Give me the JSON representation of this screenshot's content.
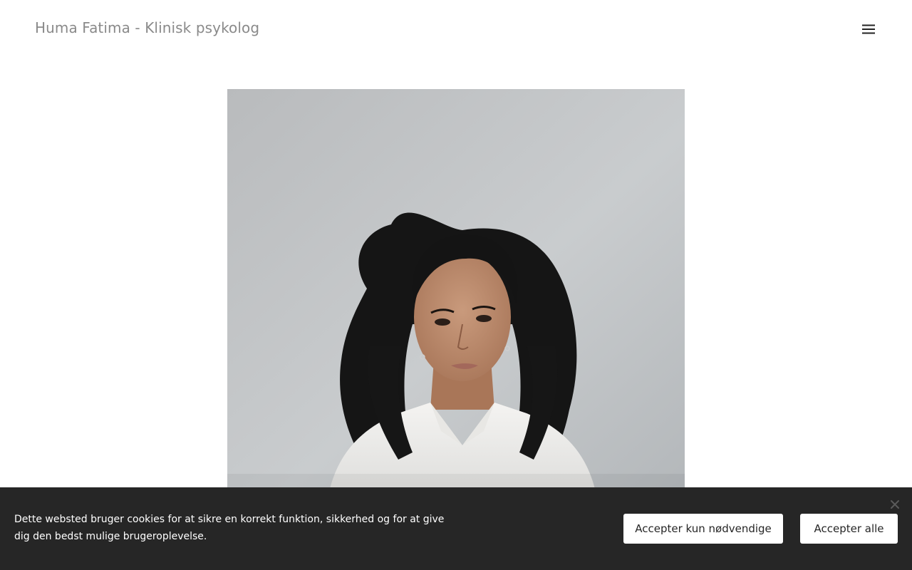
{
  "header": {
    "site_title": "Huma Fatima - Klinisk psykolog",
    "menu_icon": "hamburger-menu-icon"
  },
  "main": {
    "photo_icon": "portrait-photo"
  },
  "cookie_banner": {
    "text": "Dette websted bruger cookies for at sikre en korrekt funktion, sikkerhed og for at give dig den bedst mulige brugeroplevelse.",
    "accept_necessary_label": "Accepter kun nødvendige",
    "accept_all_label": "Accepter alle",
    "close_icon": "close-icon",
    "background_color": "#262626"
  }
}
